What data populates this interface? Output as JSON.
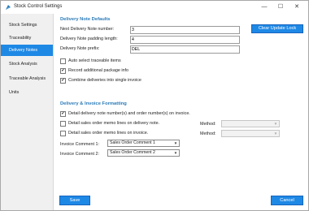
{
  "window": {
    "title": "Stock Control Settings",
    "controls": {
      "minimize": "—",
      "maximize": "☐",
      "close": "✕"
    }
  },
  "sidebar": {
    "items": [
      {
        "label": "Stock Settings",
        "active": false
      },
      {
        "label": "Traceability",
        "active": false
      },
      {
        "label": "Delivery Notes",
        "active": true
      },
      {
        "label": "Stock Analysis",
        "active": false
      },
      {
        "label": "Traceable Analysis",
        "active": false
      },
      {
        "label": "Units",
        "active": false
      }
    ]
  },
  "defaults": {
    "title": "Delivery Note Defaults",
    "next_number_label": "Next Delivery Note number:",
    "next_number_value": "3",
    "padding_label": "Delivery Note padding length:",
    "padding_value": "4",
    "prefix_label": "Delivery Note prefix:",
    "prefix_value": "DEL",
    "clear_button": "Clear Update Lock",
    "options": [
      {
        "label": "Auto select traceable items",
        "checked": false
      },
      {
        "label": "Record additional package info",
        "checked": true
      },
      {
        "label": "Combine deliveries into single invoice",
        "checked": true
      }
    ]
  },
  "formatting": {
    "title": "Delivery & Invoice Formatting",
    "detail_numbers_label": "Detail delivery note number(s) and order number(s) on invoice.",
    "detail_numbers_checked": true,
    "memo_delivery_label": "Detail sales order memo lines on delivery note.",
    "memo_delivery_checked": false,
    "memo_invoice_label": "Detail sales order memo lines on invoice.",
    "memo_invoice_checked": false,
    "method_label": "Method:",
    "method_value_1": "",
    "method_value_2": "",
    "invoice_comment_1_label": "Invoice Comment 1:",
    "invoice_comment_1_value": "Sales Order Comment 1",
    "invoice_comment_2_label": "Invoice Comment 2:",
    "invoice_comment_2_value": "Sales Order Comment 2"
  },
  "footer": {
    "save_label": "Save",
    "cancel_label": "Cancel"
  },
  "colors": {
    "accent": "#1e88e5",
    "section_title": "#2a7ab8",
    "sidebar_bg": "#f0f0f0"
  },
  "icons": {
    "app": "stock-control-app-icon",
    "dropdown": "chevron-down-icon"
  }
}
